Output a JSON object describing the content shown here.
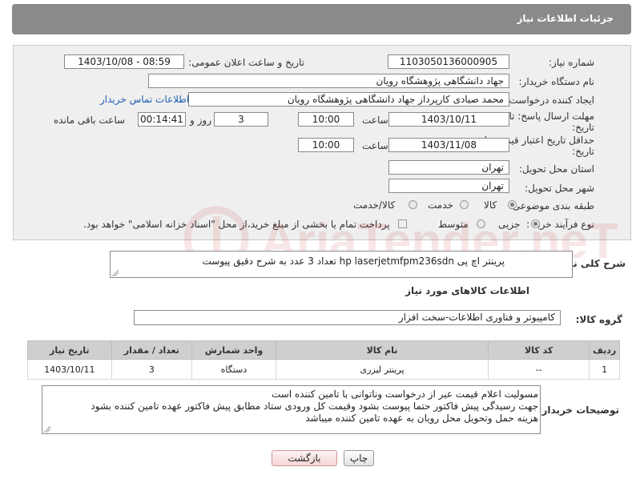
{
  "header": {
    "title": "جزئیات اطلاعات نیاز"
  },
  "fields": {
    "need_number_label": "شماره نیاز:",
    "need_number": "1103050136000905",
    "announce_label": "تاریخ و ساعت اعلان عمومی:",
    "announce_value": "1403/10/08 - 08:59",
    "buyer_org_label": "نام دستگاه خریدار:",
    "buyer_org": "جهاد دانشگاهی پژوهشگاه رویان",
    "requester_label": "ایجاد کننده درخواست:",
    "requester": "محمد صیادی کارپرداز جهاد دانشگاهی پژوهشگاه رویان",
    "contact_link": "اطلاعات تماس خریدار",
    "deadline_label_line1": "مهلت ارسال پاسخ: تا",
    "deadline_label_line2": "تاریخ:",
    "deadline_date": "1403/10/11",
    "time_label": "ساعت",
    "deadline_time": "10:00",
    "days_value": "3",
    "days_label": "روز و",
    "remaining_time": "00:14:41",
    "remaining_label": "ساعت باقی مانده",
    "validity_label_line1": "حداقل تاریخ اعتبار قیمت: تا",
    "validity_label_line2": "تاریخ:",
    "validity_date": "1403/11/08",
    "validity_time": "10:00",
    "province_label": "استان محل تحویل:",
    "province": "تهران",
    "city_label": "شهر محل تحویل:",
    "city": "تهران",
    "category_label": "طبقه بندی موضوعی:",
    "category_options": [
      "کالا",
      "خدمت",
      "کالا/خدمت"
    ],
    "process_label": "نوع فرآیند خرید :",
    "process_options": [
      "جزیی",
      "متوسط"
    ],
    "payment_note": "پرداخت تمام یا بخشی از مبلغ خرید،از محل \"اسناد خزانه اسلامی\" خواهد بود."
  },
  "description": {
    "label": "شرح کلی نیاز:",
    "text": "پرینتر اچ پی hp laserjetmfpm236sdn تعداد 3 عدد به شرح دقیق پیوست"
  },
  "goods": {
    "section_title": "اطلاعات کالاهای مورد نیاز",
    "group_label": "گروه کالا:",
    "group_value": "کامپیوتر و فناوری اطلاعات-سخت افزار",
    "columns": [
      "ردیف",
      "کد کالا",
      "نام کالا",
      "واحد شمارش",
      "تعداد / مقدار",
      "تاریخ نیاز"
    ],
    "rows": [
      {
        "row": "1",
        "code": "--",
        "name": "پرینتر لیزری",
        "unit": "دستگاه",
        "qty": "3",
        "date": "1403/10/11"
      }
    ]
  },
  "buyer_notes": {
    "label": "توضیحات خریدار:",
    "lines": [
      "مسولیت اعلام قیمت  عیر از درخواست وناتوانی با تامین کننده است",
      "جهت رسیدگی پیش فاکتور حتما پیوست بشود وقیمت کل ورودی ستاد مطابق پیش فاکتور عهده تامین کننده بشود",
      "هزینه حمل وتحویل محل رویان به عهده تامین کننده میباشد"
    ]
  },
  "buttons": {
    "print": "چاپ",
    "back": "بازگشت"
  },
  "watermark": {
    "text": "AriaTender.neT",
    "color": "#c62828"
  }
}
